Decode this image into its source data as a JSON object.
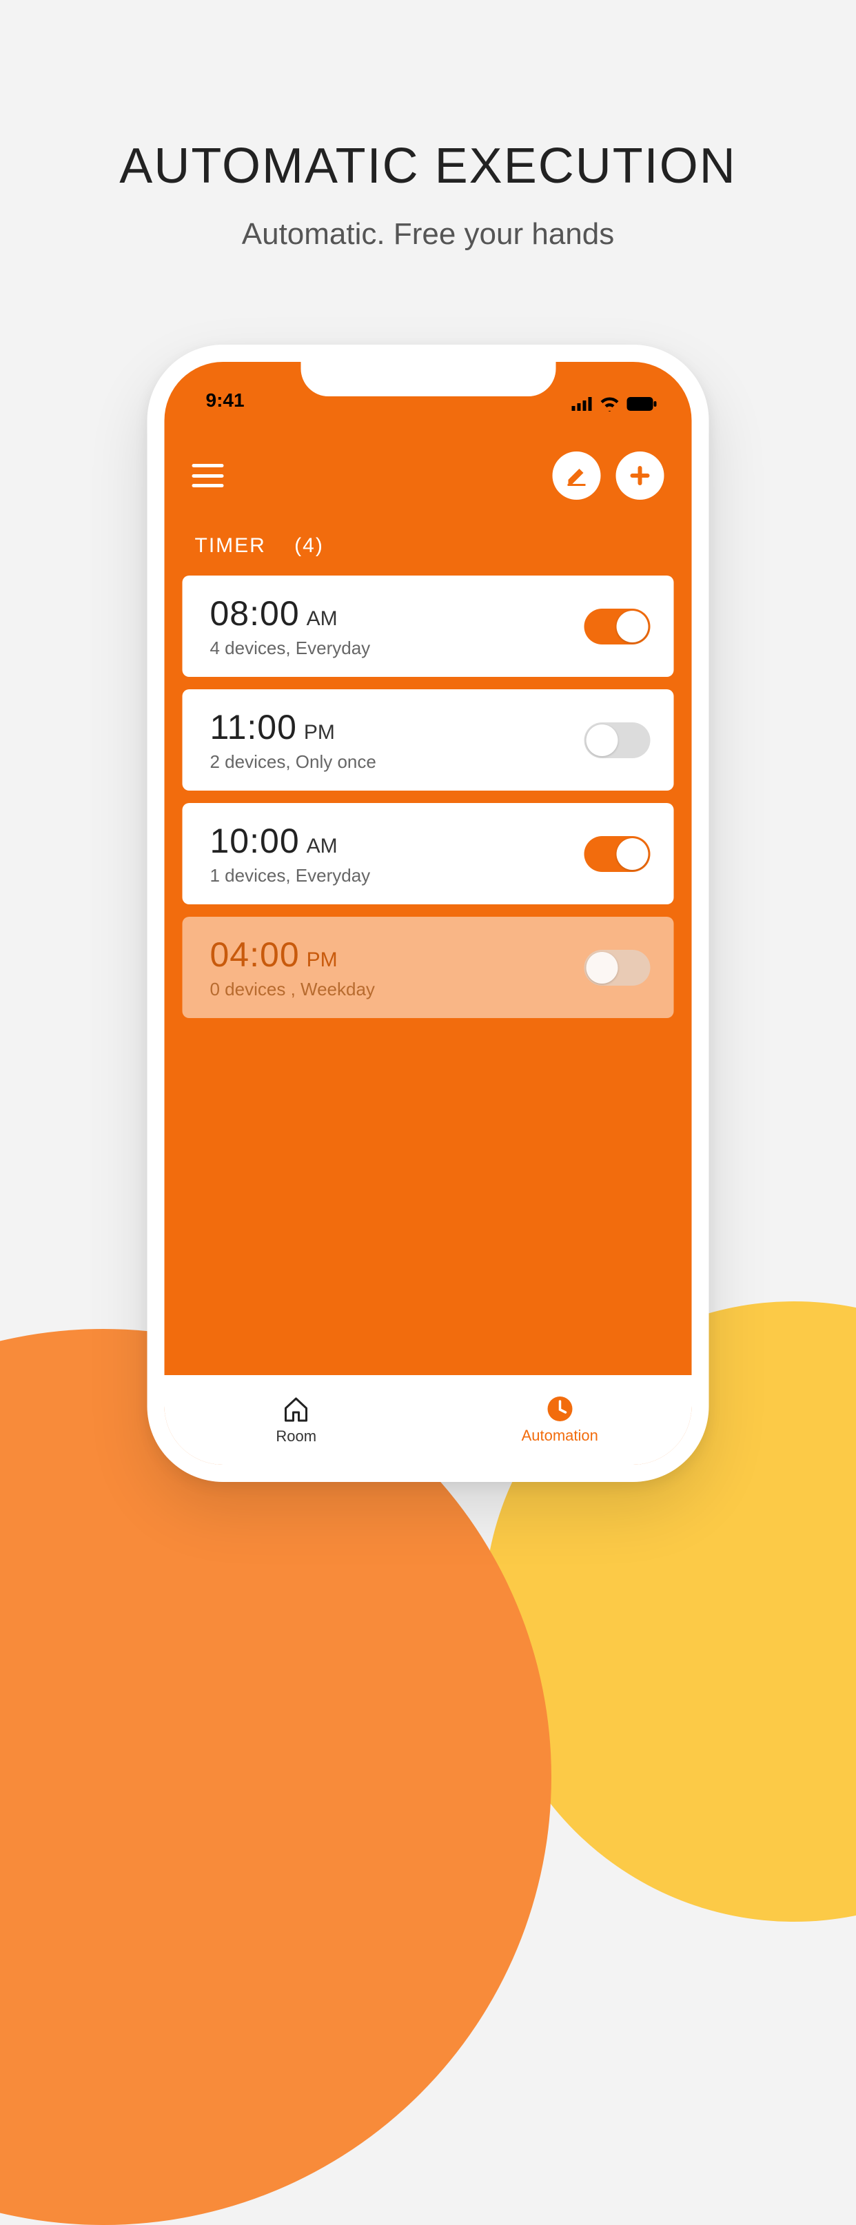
{
  "hero": {
    "title": "AUTOMATIC EXECUTION",
    "subtitle": "Automatic. Free your hands"
  },
  "status": {
    "time": "9:41"
  },
  "section": {
    "label": "TIMER",
    "count": "(4)"
  },
  "timers": [
    {
      "time": "08:00",
      "ampm": "AM",
      "sub": "4 devices,  Everyday",
      "on": true,
      "dim": false
    },
    {
      "time": "11:00",
      "ampm": "PM",
      "sub": "2 devices, Only once",
      "on": false,
      "dim": false
    },
    {
      "time": "10:00",
      "ampm": "AM",
      "sub": "1 devices,  Everyday",
      "on": true,
      "dim": false
    },
    {
      "time": "04:00",
      "ampm": "PM",
      "sub": "0 devices , Weekday",
      "on": false,
      "dim": true
    }
  ],
  "nav": {
    "room": "Room",
    "automation": "Automation"
  },
  "colors": {
    "accent": "#f26c0d"
  }
}
